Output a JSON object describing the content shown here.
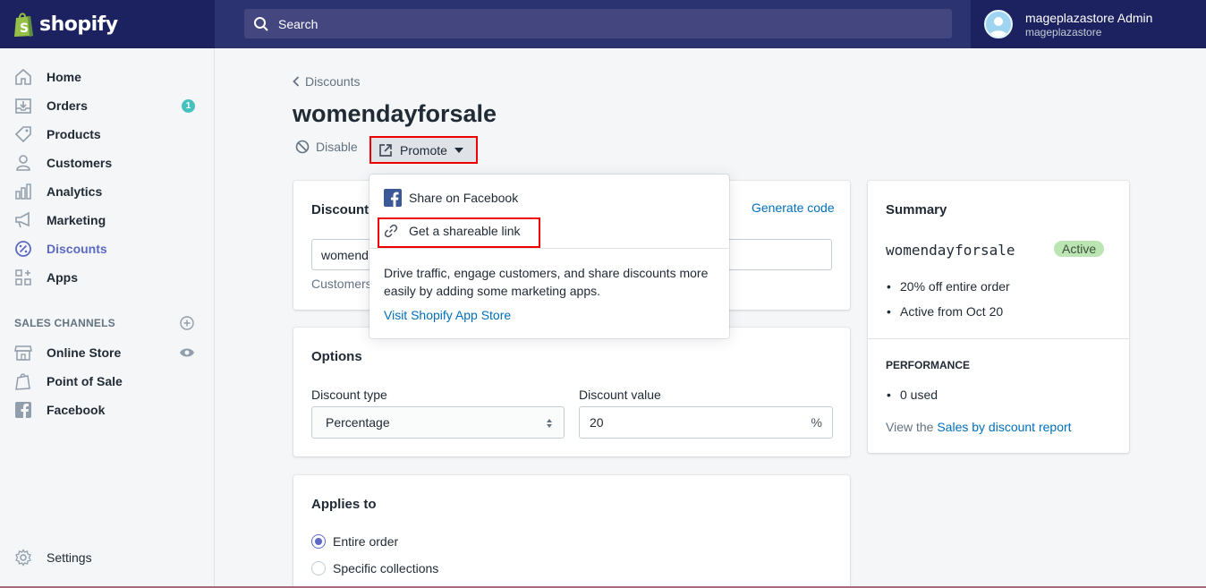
{
  "brand": {
    "name": "shopify"
  },
  "search": {
    "placeholder": "Search"
  },
  "user": {
    "name": "mageplazastore Admin",
    "store": "mageplazastore"
  },
  "sidebar": {
    "items": [
      {
        "label": "Home",
        "icon": "home-icon"
      },
      {
        "label": "Orders",
        "icon": "orders-icon",
        "badge": "1"
      },
      {
        "label": "Products",
        "icon": "tag-icon"
      },
      {
        "label": "Customers",
        "icon": "person-icon"
      },
      {
        "label": "Analytics",
        "icon": "bar-chart-icon"
      },
      {
        "label": "Marketing",
        "icon": "megaphone-icon"
      },
      {
        "label": "Discounts",
        "icon": "discount-icon",
        "active": true
      },
      {
        "label": "Apps",
        "icon": "apps-icon"
      }
    ],
    "sales_channels_heading": "SALES CHANNELS",
    "channels": [
      {
        "label": "Online Store",
        "icon": "store-icon"
      },
      {
        "label": "Point of Sale",
        "icon": "pos-icon"
      },
      {
        "label": "Facebook",
        "icon": "facebook-icon"
      }
    ],
    "settings_label": "Settings"
  },
  "page": {
    "breadcrumb": "Discounts",
    "title": "womendayforsale",
    "actions": {
      "disable": "Disable",
      "promote": "Promote"
    }
  },
  "promote_menu": {
    "items": [
      {
        "label": "Share on Facebook",
        "icon": "facebook-icon"
      },
      {
        "label": "Get a shareable link",
        "icon": "link-icon"
      }
    ],
    "description": "Drive traffic, engage customers, and share discounts more easily by adding some marketing apps.",
    "app_store_link": "Visit Shopify App Store"
  },
  "discount_code_card": {
    "title_visible": "Discount",
    "generate_code": "Generate code",
    "code_value_visible": "womend",
    "helper_visible": "Customers"
  },
  "options_card": {
    "title": "Options",
    "type_label": "Discount type",
    "type_value": "Percentage",
    "value_label": "Discount value",
    "value": "20",
    "value_suffix": "%"
  },
  "applies_card": {
    "title": "Applies to",
    "options": [
      {
        "label": "Entire order",
        "selected": true
      },
      {
        "label": "Specific collections",
        "selected": false
      }
    ]
  },
  "summary": {
    "title": "Summary",
    "code": "womendayforsale",
    "status": "Active",
    "details": [
      "20% off entire order",
      "Active from Oct 20"
    ],
    "performance_heading": "PERFORMANCE",
    "performance": [
      "0 used"
    ],
    "report_prefix": "View the",
    "report_link": "Sales by discount report"
  },
  "colors": {
    "topbar": "#1c2260",
    "accent": "#5c6ac4",
    "link": "#006fbb",
    "highlight_box": "#ee0000",
    "active_badge": "#bbe5b3"
  }
}
